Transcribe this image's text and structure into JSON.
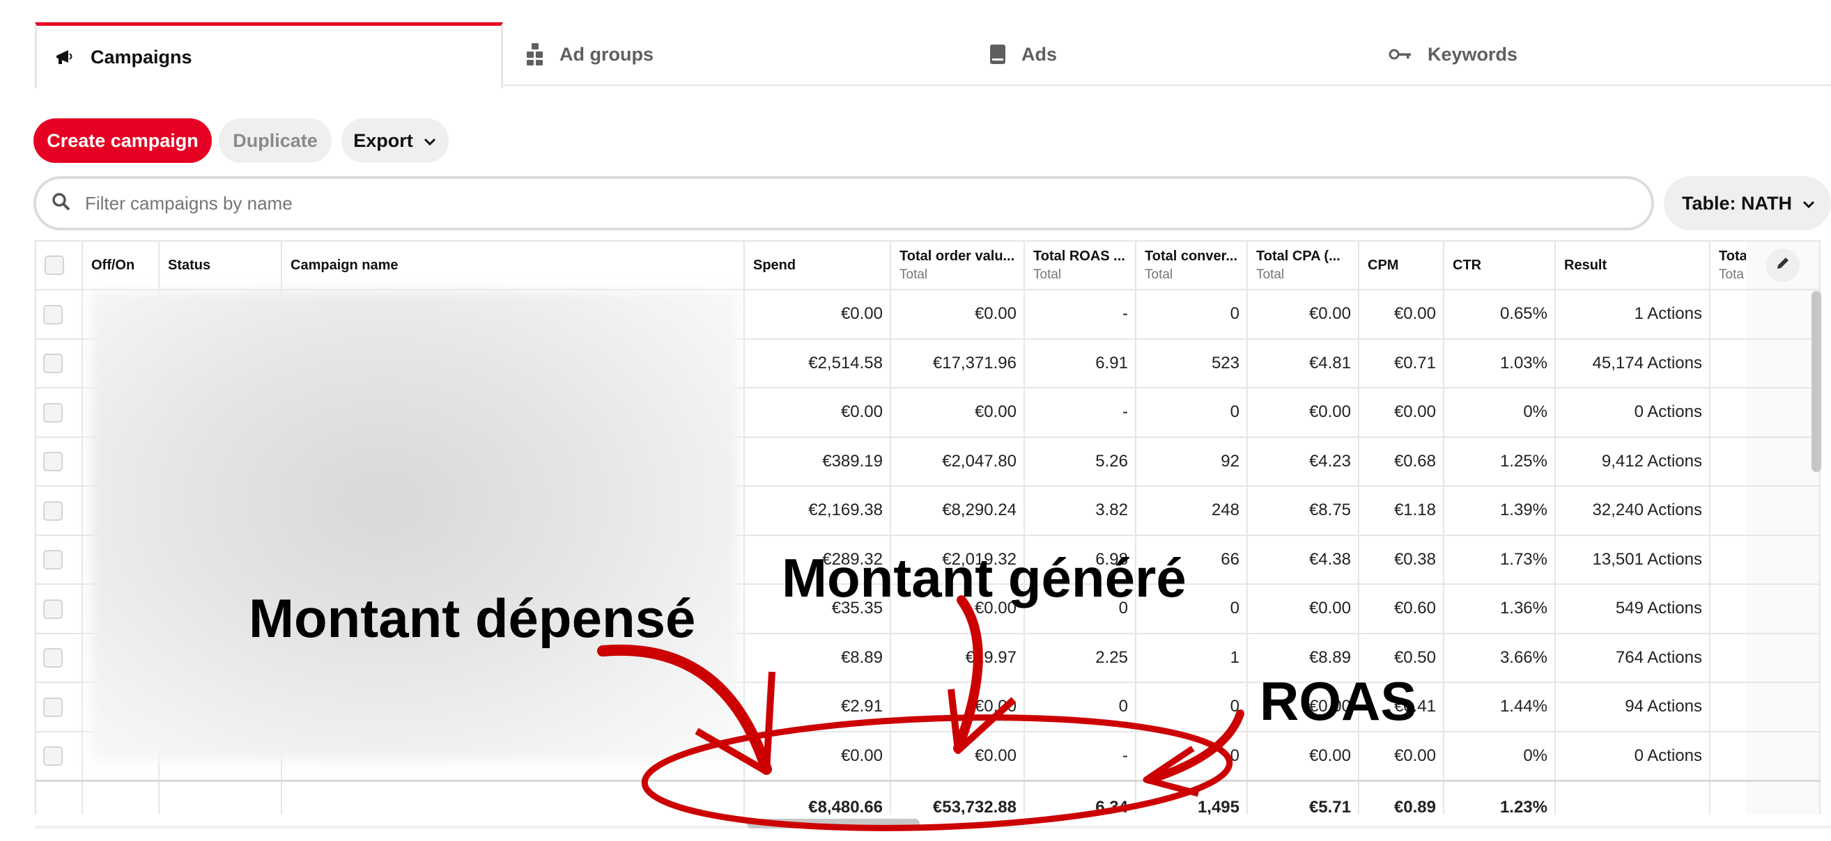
{
  "tabs": [
    {
      "label": "Campaigns",
      "icon": "megaphone-icon",
      "active": true
    },
    {
      "label": "Ad groups",
      "icon": "ad-groups-icon",
      "active": false
    },
    {
      "label": "Ads",
      "icon": "ad-icon",
      "active": false
    },
    {
      "label": "Keywords",
      "icon": "key-icon",
      "active": false
    }
  ],
  "toolbar": {
    "create_label": "Create campaign",
    "duplicate_label": "Duplicate",
    "export_label": "Export"
  },
  "search": {
    "placeholder": "Filter campaigns by name"
  },
  "table_select": {
    "label": "Table: NATH"
  },
  "table": {
    "headers": [
      {
        "label": "Off/On",
        "sub": ""
      },
      {
        "label": "Status",
        "sub": ""
      },
      {
        "label": "Campaign name",
        "sub": ""
      },
      {
        "label": "Spend",
        "sub": ""
      },
      {
        "label": "Total order valu...",
        "sub": "Total"
      },
      {
        "label": "Total ROAS ...",
        "sub": "Total"
      },
      {
        "label": "Total conver...",
        "sub": "Total"
      },
      {
        "label": "Total CPA (...",
        "sub": "Total"
      },
      {
        "label": "CPM",
        "sub": ""
      },
      {
        "label": "CTR",
        "sub": ""
      },
      {
        "label": "Result",
        "sub": ""
      },
      {
        "label": "Tota",
        "sub": "Tota"
      }
    ],
    "rows": [
      [
        "€0.00",
        "€0.00",
        "-",
        "0",
        "€0.00",
        "€0.00",
        "0.65%",
        "1 Actions"
      ],
      [
        "€2,514.58",
        "€17,371.96",
        "6.91",
        "523",
        "€4.81",
        "€0.71",
        "1.03%",
        "45,174 Actions"
      ],
      [
        "€0.00",
        "€0.00",
        "-",
        "0",
        "€0.00",
        "€0.00",
        "0%",
        "0 Actions"
      ],
      [
        "€389.19",
        "€2,047.80",
        "5.26",
        "92",
        "€4.23",
        "€0.68",
        "1.25%",
        "9,412 Actions"
      ],
      [
        "€2,169.38",
        "€8,290.24",
        "3.82",
        "248",
        "€8.75",
        "€1.18",
        "1.39%",
        "32,240 Actions"
      ],
      [
        "€289.32",
        "€2,019.32",
        "6.98",
        "66",
        "€4.38",
        "€0.38",
        "1.73%",
        "13,501 Actions"
      ],
      [
        "€35.35",
        "€0.00",
        "0",
        "0",
        "€0.00",
        "€0.60",
        "1.36%",
        "549 Actions"
      ],
      [
        "€8.89",
        "€19.97",
        "2.25",
        "1",
        "€8.89",
        "€0.50",
        "3.66%",
        "764 Actions"
      ],
      [
        "€2.91",
        "€0.00",
        "0",
        "0",
        "€0.00",
        "€0.41",
        "1.44%",
        "94 Actions"
      ],
      [
        "€0.00",
        "€0.00",
        "-",
        "0",
        "€0.00",
        "€0.00",
        "0%",
        "0 Actions"
      ]
    ],
    "totals": [
      "€8,480.66",
      "€53,732.88",
      "6.34",
      "1,495",
      "€5.71",
      "€0.89",
      "1.23%",
      ""
    ]
  },
  "annotations": {
    "spent": "Montant dépensé",
    "generated": "Montant généré",
    "roas": "ROAS"
  },
  "colors": {
    "accent": "#e60023",
    "annotation_red": "#cc0000"
  }
}
